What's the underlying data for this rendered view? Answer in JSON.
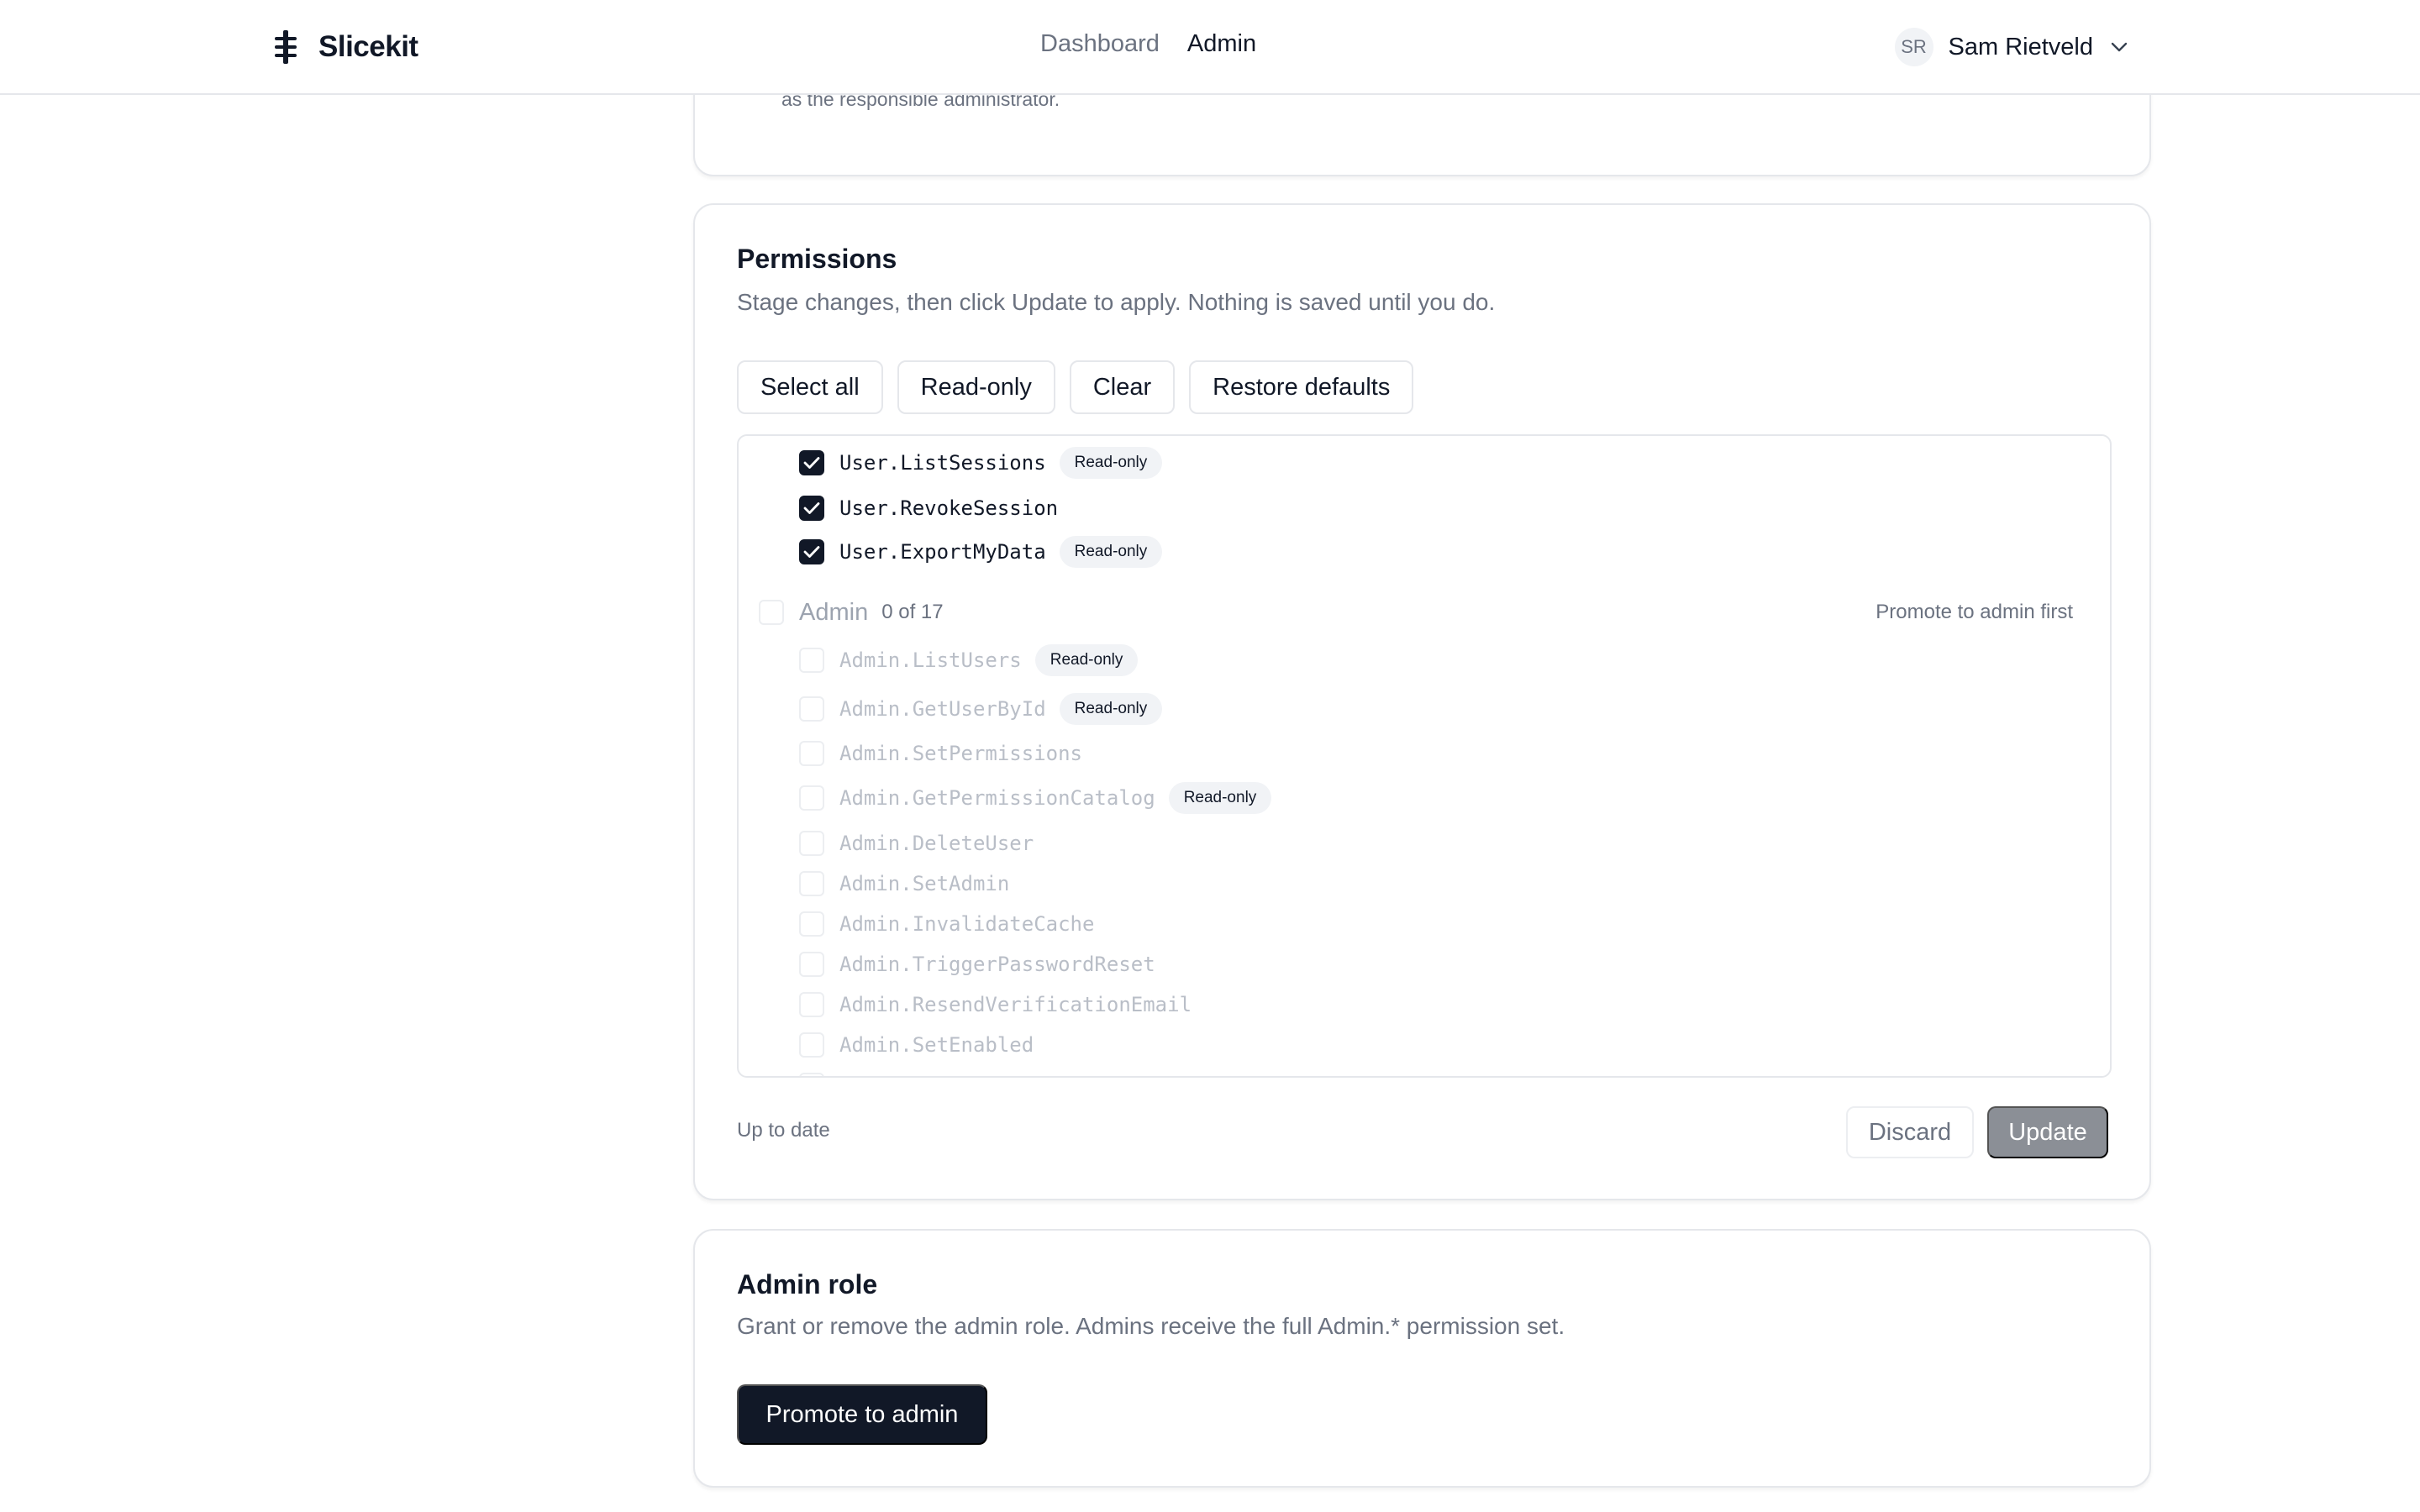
{
  "app": {
    "name": "Slicekit"
  },
  "nav": {
    "items": [
      {
        "label": "Dashboard",
        "active": false
      },
      {
        "label": "Admin",
        "active": true
      }
    ]
  },
  "user": {
    "initials": "SR",
    "name": "Sam Rietveld"
  },
  "previous_card": {
    "text": "as the responsible administrator."
  },
  "permissions": {
    "title": "Permissions",
    "subtitle": "Stage changes, then click Update to apply. Nothing is saved until you do.",
    "actions": [
      "Select all",
      "Read-only",
      "Clear",
      "Restore defaults"
    ],
    "user_items": [
      {
        "name": "User.ListSessions",
        "checked": true,
        "badge": "Read-only"
      },
      {
        "name": "User.RevokeSession",
        "checked": true,
        "badge": ""
      },
      {
        "name": "User.ExportMyData",
        "checked": true,
        "badge": "Read-only"
      }
    ],
    "admin_group": {
      "label": "Admin",
      "count": "0 of 17",
      "note": "Promote to admin first",
      "checked": false
    },
    "admin_items": [
      {
        "name": "Admin.ListUsers",
        "checked": false,
        "badge": "Read-only"
      },
      {
        "name": "Admin.GetUserById",
        "checked": false,
        "badge": "Read-only"
      },
      {
        "name": "Admin.SetPermissions",
        "checked": false,
        "badge": ""
      },
      {
        "name": "Admin.GetPermissionCatalog",
        "checked": false,
        "badge": "Read-only"
      },
      {
        "name": "Admin.DeleteUser",
        "checked": false,
        "badge": ""
      },
      {
        "name": "Admin.SetAdmin",
        "checked": false,
        "badge": ""
      },
      {
        "name": "Admin.InvalidateCache",
        "checked": false,
        "badge": ""
      },
      {
        "name": "Admin.TriggerPasswordReset",
        "checked": false,
        "badge": ""
      },
      {
        "name": "Admin.ResendVerificationEmail",
        "checked": false,
        "badge": ""
      },
      {
        "name": "Admin.SetEnabled",
        "checked": false,
        "badge": ""
      }
    ],
    "status": "Up to date",
    "discard_label": "Discard",
    "update_label": "Update"
  },
  "admin_role": {
    "title": "Admin role",
    "subtitle": "Grant or remove the admin role. Admins receive the full Admin.* permission set.",
    "button_label": "Promote to admin"
  },
  "colors": {
    "primary": "#111827",
    "muted": "#6b7280",
    "border": "#e5e7eb",
    "badge_bg": "#f1f3f6",
    "update_disabled": "#8b8f96"
  }
}
